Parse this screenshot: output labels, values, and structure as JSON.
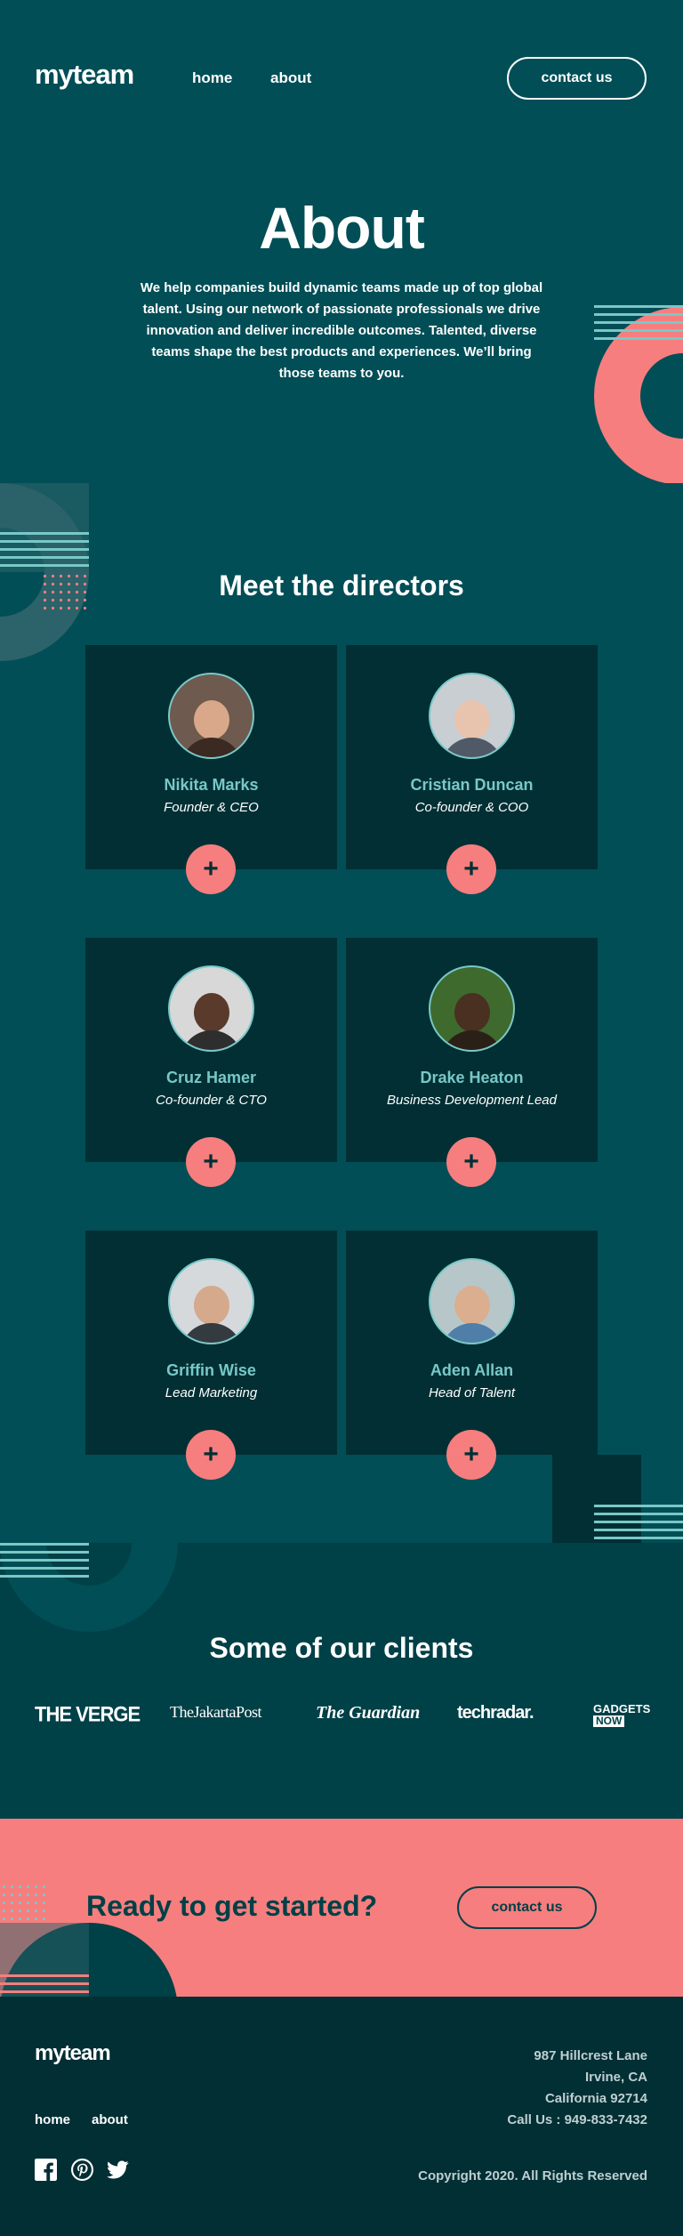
{
  "header": {
    "logo": "myteam",
    "nav": {
      "home": "home",
      "about": "about"
    },
    "contact_label": "contact us"
  },
  "hero": {
    "title": "About",
    "text": "We help companies build dynamic teams made up of top global talent. Using our network of passionate professionals we drive innovation and deliver incredible outcomes. Talented, diverse teams shape the best products and experiences. We’ll bring those teams to you."
  },
  "directors": {
    "title": "Meet the directors",
    "items": [
      {
        "name": "Nikita Marks",
        "role": "Founder & CEO",
        "plus": "+"
      },
      {
        "name": "Cristian Duncan",
        "role": "Co-founder & COO",
        "plus": "+"
      },
      {
        "name": "Cruz Hamer",
        "role": "Co-founder & CTO",
        "plus": "+"
      },
      {
        "name": "Drake Heaton",
        "role": "Business Development Lead",
        "plus": "+"
      },
      {
        "name": "Griffin Wise",
        "role": "Lead Marketing",
        "plus": "+"
      },
      {
        "name": "Aden Allan",
        "role": "Head of Talent",
        "plus": "+"
      }
    ]
  },
  "clients": {
    "title": "Some of our clients",
    "logos": {
      "verge": "THE VERGE",
      "jakarta": "TheJakartaPost",
      "guardian": "The Guardian",
      "techradar": "techradar.",
      "gadgets": "GADGETS",
      "gadgets_now": "NOW"
    }
  },
  "cta": {
    "title": "Ready to get started?",
    "button": "contact us"
  },
  "footer": {
    "logo": "myteam",
    "nav": {
      "home": "home",
      "about": "about"
    },
    "address": {
      "line1": "987 Hillcrest Lane",
      "line2": "Irvine, CA",
      "line3": "California 92714",
      "phone": "Call Us : 949-833-7432"
    },
    "copyright": "Copyright 2020. All Rights Reserved"
  },
  "colors": {
    "dark_green": "#004047",
    "mid_green": "#014e56",
    "darkest_green": "#012f34",
    "coral": "#f67e7e",
    "light_teal": "#79c8c7"
  }
}
